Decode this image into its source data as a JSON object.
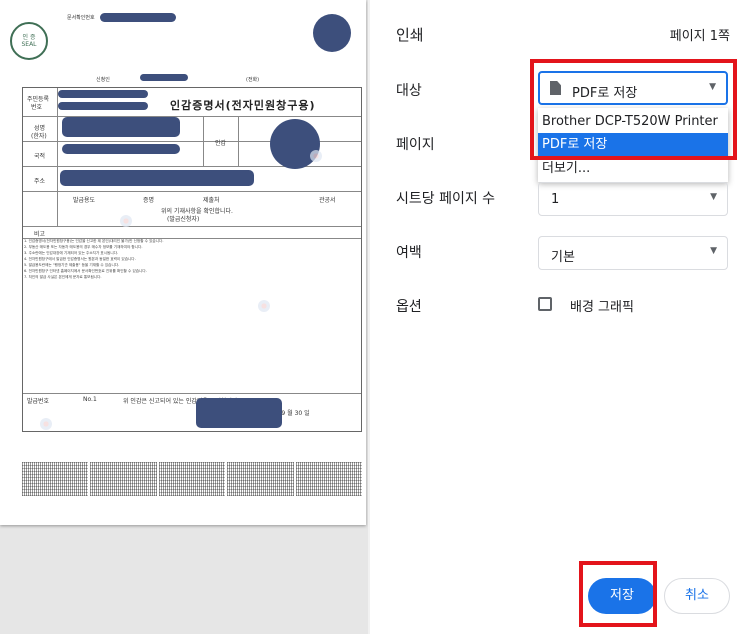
{
  "dialog": {
    "title": "인쇄",
    "page_count": "페이지 1쪽"
  },
  "destination": {
    "label": "대상",
    "selected": "PDF로 저장",
    "options": [
      "Brother DCP-T520W Printer",
      "PDF로 저장",
      "더보기..."
    ],
    "highlighted_index": 1
  },
  "pages": {
    "label": "페이지"
  },
  "pages_per_sheet": {
    "label": "시트당 페이지 수",
    "value": "1"
  },
  "margins": {
    "label": "여백",
    "value": "기본"
  },
  "options": {
    "label": "옵션",
    "background_graphics_label": "배경 그래픽",
    "background_graphics_checked": false
  },
  "buttons": {
    "save": "저장",
    "cancel": "취소"
  },
  "colors": {
    "accent": "#1a73e8",
    "highlight_frame": "#e3141b",
    "redaction": "#3d4f7c"
  },
  "document": {
    "title": "인감증명서(전자민원창구용)",
    "verify_label": "문서확인번호",
    "applicant_label": "신청인",
    "phone_label": "(전화)",
    "reg_label_1": "주민등록",
    "reg_label_2": "번호",
    "name_label_1": "성명",
    "name_label_2": "(한자)",
    "nationality_label": "국적",
    "address_label": "주소",
    "seal_label": "인감",
    "usage_col": "발급용도",
    "usage_vals": [
      "증명",
      "제출처",
      "관공서"
    ],
    "confirm_text": "위의 기재사항을 확인합니다.",
    "confirm_sub": "(발급신청자)",
    "remark_label": "비고",
    "issue_no_label": "발급번호",
    "issue_no": "No.1",
    "certify_text": "위 인감은 신고되어 있는 인감임을 증명합니다.",
    "date": "2024 년 09 월 30 일",
    "seal_text": [
      "인 증",
      "SEAL"
    ]
  }
}
